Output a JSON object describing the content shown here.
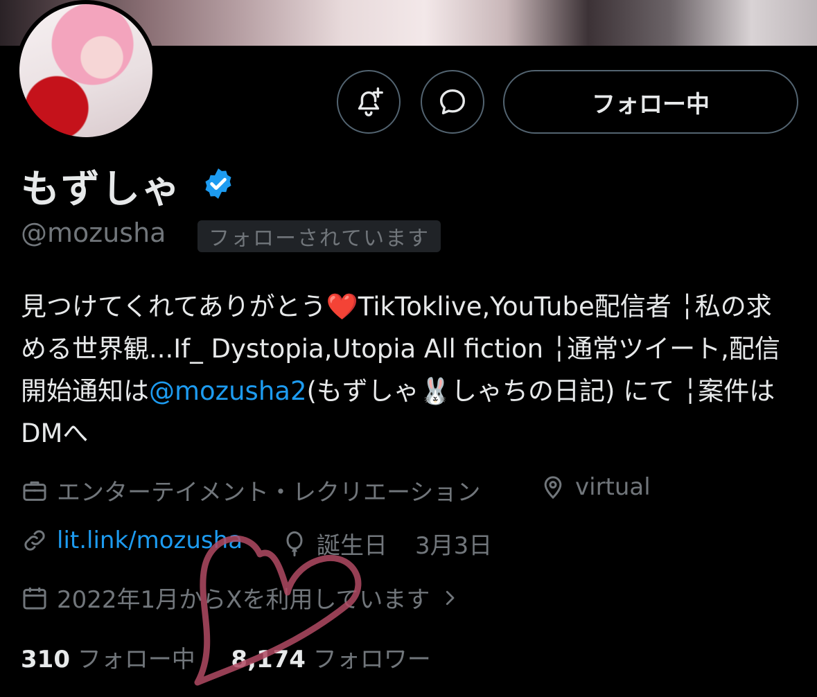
{
  "profile": {
    "name": "もずしゃ",
    "handle": "@mozusha",
    "follows_you": "フォローされています",
    "follow_button": "フォロー中",
    "bio": {
      "part1": "見つけてくれてありがとう",
      "heart_emoji": "❤️",
      "part2": "TikToklive,YouTube配信者 ╎私の求める世界観...If_ Dystopia,Utopia All fiction ╎通常ツイート,配信開始通知は",
      "mention": "@mozusha2",
      "part3": "(もずしゃ",
      "rabbit_emoji": "🐰",
      "part4": "しゃちの日記) にて ╎案件はDMへ"
    },
    "category": "エンターテイメント・レクリエーション",
    "location": "virtual",
    "website": "lit.link/mozusha",
    "birthday_label": "誕生日",
    "birthday": "3月3日",
    "joined": "2022年1月からXを利用しています",
    "following_count": "310",
    "following_label": "フォロー中",
    "followers_count": "8,174",
    "followers_label": "フォロワー"
  },
  "colors": {
    "background": "#000000",
    "text": "#e7e9ea",
    "muted": "#71767b",
    "accent": "#1d9bf0",
    "border": "#536471",
    "doodle": "#b04a63"
  },
  "icons": [
    "notification-bell-plus-icon",
    "message-icon",
    "verified-badge-icon",
    "briefcase-icon",
    "location-pin-icon",
    "link-icon",
    "balloon-icon",
    "calendar-icon",
    "chevron-right-icon"
  ]
}
